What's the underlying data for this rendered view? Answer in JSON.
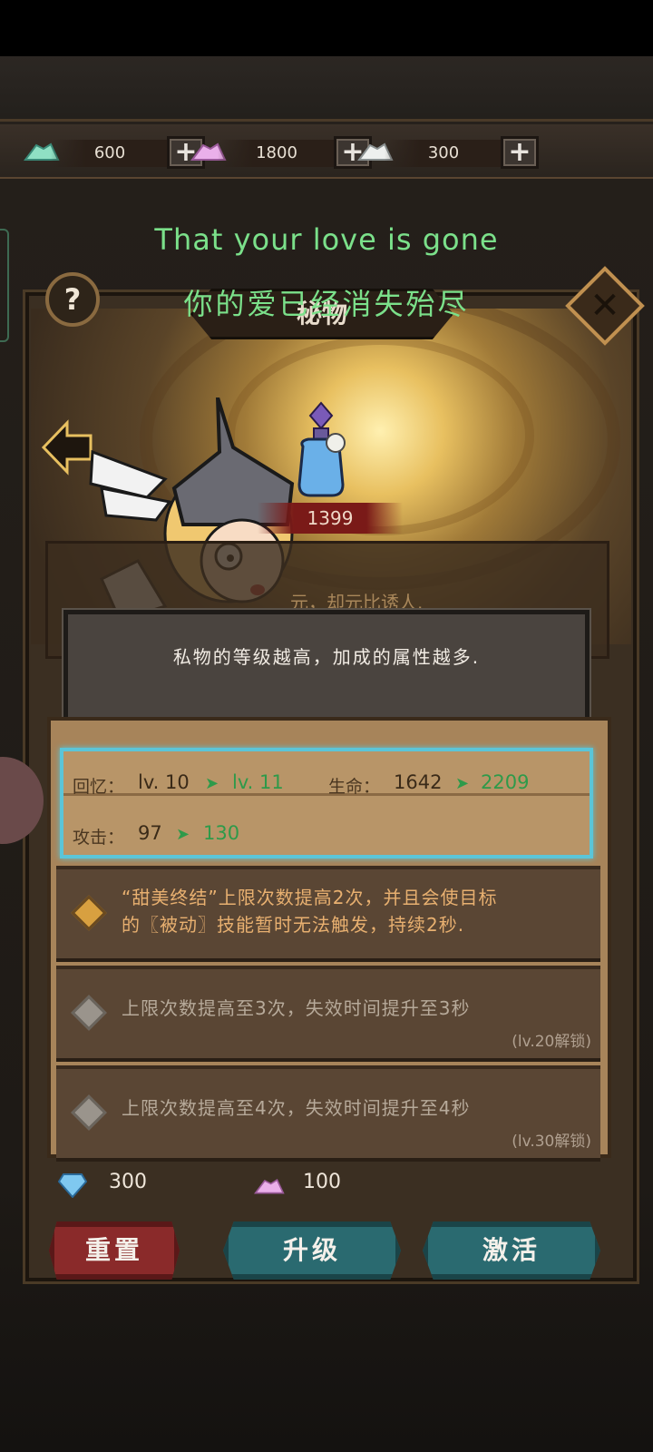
{
  "currencies": [
    {
      "name": "teal-crystal",
      "value": "600",
      "color": "#7fd6b8"
    },
    {
      "name": "pink-crystal",
      "value": "1800",
      "color": "#e6a8e8"
    },
    {
      "name": "white-crystal",
      "value": "300",
      "color": "#e8ecea"
    }
  ],
  "subtitles": {
    "english": "That your love is gone",
    "chinese": "你的爱已经消失殆尽"
  },
  "dialog": {
    "title": "秘物",
    "help_label": "?",
    "close_label": "✕",
    "item_price": "1399",
    "flavor_text": "元，却元比诱人.",
    "tip": "私物的等级越高，加成的属性越多."
  },
  "stats": {
    "memory_label": "回忆：",
    "memory_from": "lv. 10",
    "memory_to": "lv. 11",
    "hp_label": "生命：",
    "hp_from": "1642",
    "hp_to": "2209",
    "atk_label": "攻击：",
    "atk_from": "97",
    "atk_to": "130",
    "arrow": "➤"
  },
  "skills": [
    {
      "line1": "“甜美终结”上限次数提高2次，并且会使目标",
      "line2": "的〖被动〗技能暂时无法触发，持续2秒.",
      "unlock": "",
      "active": true
    },
    {
      "line1": "上限次数提高至3次，失效时间提升至3秒",
      "line2": "",
      "unlock": "(lv.20解锁)",
      "active": false
    },
    {
      "line1": "上限次数提高至4次，失效时间提升至4秒",
      "line2": "",
      "unlock": "(lv.30解锁)",
      "active": false
    }
  ],
  "costs": {
    "reset_cost": "300",
    "upgrade_cost": "100"
  },
  "buttons": {
    "reset": "重置",
    "upgrade": "升级",
    "activate": "激活"
  },
  "colors": {
    "highlight_border": "#5bc5d8",
    "stat_increase": "#2e9a4a",
    "active_skill_text": "#e8b070",
    "inactive_skill_text": "#b7aa9a",
    "subtitle": "#7be08a"
  }
}
